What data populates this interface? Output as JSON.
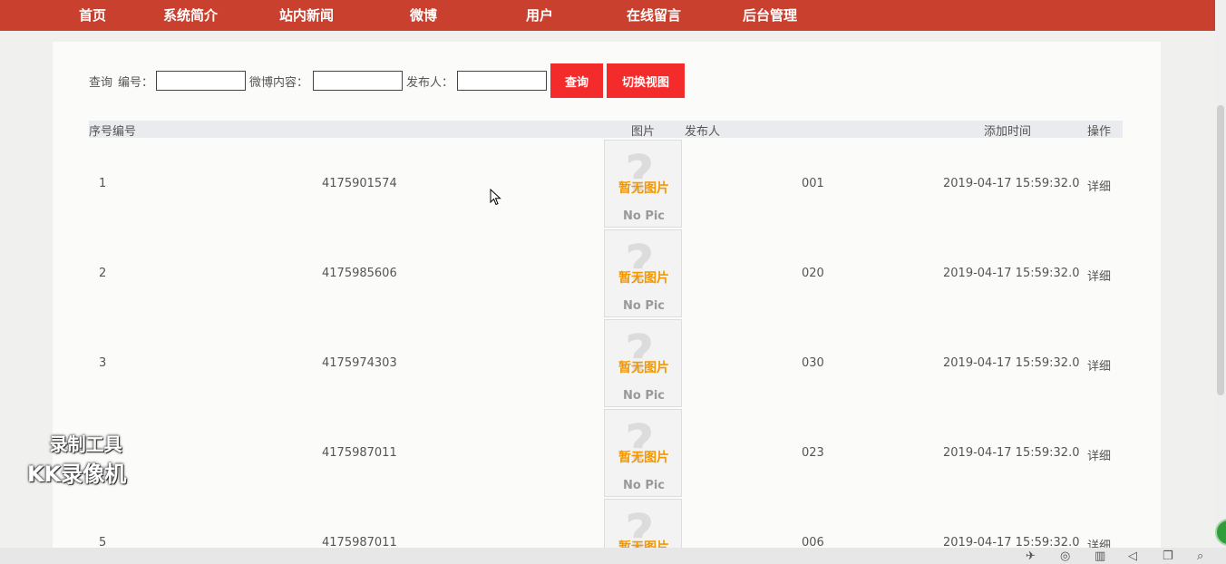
{
  "nav": {
    "items": [
      "首页",
      "系统简介",
      "站内新闻",
      "微博",
      "用户",
      "在线留言",
      "后台管理"
    ]
  },
  "search": {
    "label_query": "查询",
    "label_number": "编号：",
    "label_content": "微博内容：",
    "label_publisher": "发布人：",
    "number_value": "",
    "content_value": "",
    "publisher_value": "",
    "query_button": "查询",
    "switch_view_button": "切换视图"
  },
  "table": {
    "headers": {
      "index_number": "序号编号",
      "image": "图片",
      "publisher": "发布人",
      "added_time": "添加时间",
      "action": "操作"
    },
    "rows": [
      {
        "index": "1",
        "number": "4175901574",
        "publisher": "001",
        "time": "2019-04-17 15:59:32.0",
        "action": "详细"
      },
      {
        "index": "2",
        "number": "4175985606",
        "publisher": "020",
        "time": "2019-04-17 15:59:32.0",
        "action": "详细"
      },
      {
        "index": "3",
        "number": "4175974303",
        "publisher": "030",
        "time": "2019-04-17 15:59:32.0",
        "action": "详细"
      },
      {
        "index": "",
        "number": "4175987011",
        "publisher": "023",
        "time": "2019-04-17 15:59:32.0",
        "action": "详细"
      },
      {
        "index": "5",
        "number": "4175987011",
        "publisher": "006",
        "time": "2019-04-17 15:59:32.0",
        "action": "详细"
      }
    ],
    "no_pic_cn": "暂无图片",
    "no_pic_en": "No Pic"
  },
  "watermark": {
    "line1": "录制工具",
    "line2": "KK录像机"
  },
  "colors": {
    "nav_bg": "#c9402f",
    "button_bg": "#f42b2b",
    "no_pic_text": "#f39800"
  }
}
